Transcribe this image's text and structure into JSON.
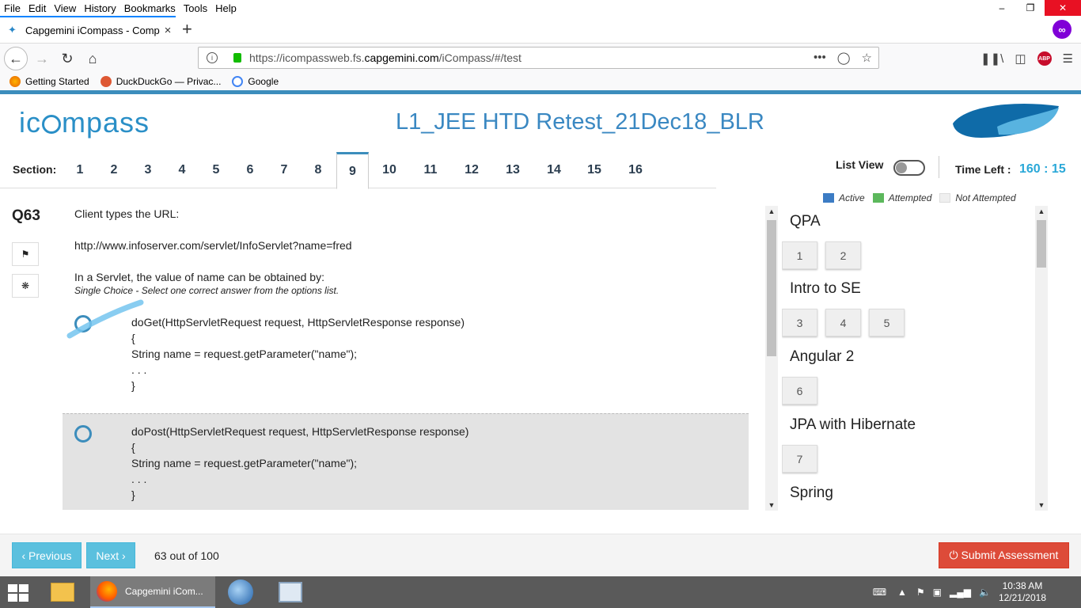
{
  "browser": {
    "menu": [
      "File",
      "Edit",
      "View",
      "History",
      "Bookmarks",
      "Tools",
      "Help"
    ],
    "tab_title": "Capgemini iCompass - Compe",
    "url_prefix": "https://icompassweb.fs.",
    "url_domain": "capgemini.com",
    "url_path": "/iCompass/#/test",
    "bookmarks": [
      "Getting Started",
      "DuckDuckGo — Privac...",
      "Google"
    ]
  },
  "app": {
    "logo_left": "ic",
    "logo_right": "mpass",
    "test_title": "L1_JEE HTD Retest_21Dec18_BLR",
    "section_label": "Section:",
    "sections": [
      "1",
      "2",
      "3",
      "4",
      "5",
      "6",
      "7",
      "8",
      "9",
      "10",
      "11",
      "12",
      "13",
      "14",
      "15",
      "16"
    ],
    "active_section": "9",
    "list_view_label": "List View",
    "time_left_label": "Time Left :",
    "time_left_value": "160 : 15"
  },
  "question": {
    "number": "Q63",
    "line1": "Client types the URL:",
    "line2": "http://www.infoserver.com/servlet/InfoServlet?name=fred",
    "line3": "In a Servlet, the value of name can be obtained by:",
    "hint": "Single Choice - Select one correct answer from the options list.",
    "options": [
      {
        "lines": [
          "doGet(HttpServletRequest request, HttpServletResponse response)",
          "{",
          "String name = request.getParameter(\"name\");",
          ". . .",
          "}"
        ]
      },
      {
        "lines": [
          "doPost(HttpServletRequest request, HttpServletResponse response)",
          "{",
          "String name = request.getParameter(\"name\");",
          ". . .",
          "}"
        ]
      }
    ]
  },
  "legend": {
    "active": "Active",
    "attempted": "Attempted",
    "not_attempted": "Not Attempted",
    "active_color": "#3c7cc4",
    "attempted_color": "#5cb85c",
    "not_attempted_color": "#efefef"
  },
  "palette": {
    "groups": [
      {
        "name": "QPA",
        "questions": [
          "1",
          "2"
        ]
      },
      {
        "name": "Intro to SE",
        "questions": [
          "3",
          "4",
          "5"
        ]
      },
      {
        "name": "Angular 2",
        "questions": [
          "6"
        ]
      },
      {
        "name": "JPA with Hibernate",
        "questions": [
          "7"
        ]
      },
      {
        "name": "Spring",
        "questions": []
      }
    ]
  },
  "footer": {
    "previous": "‹ Previous",
    "next": "Next ›",
    "progress": "63 out of 100",
    "submit": "⏻ Submit Assessment"
  },
  "taskbar": {
    "firefox_label": "Capgemini iCom...",
    "time": "10:38 AM",
    "date": "12/21/2018"
  }
}
